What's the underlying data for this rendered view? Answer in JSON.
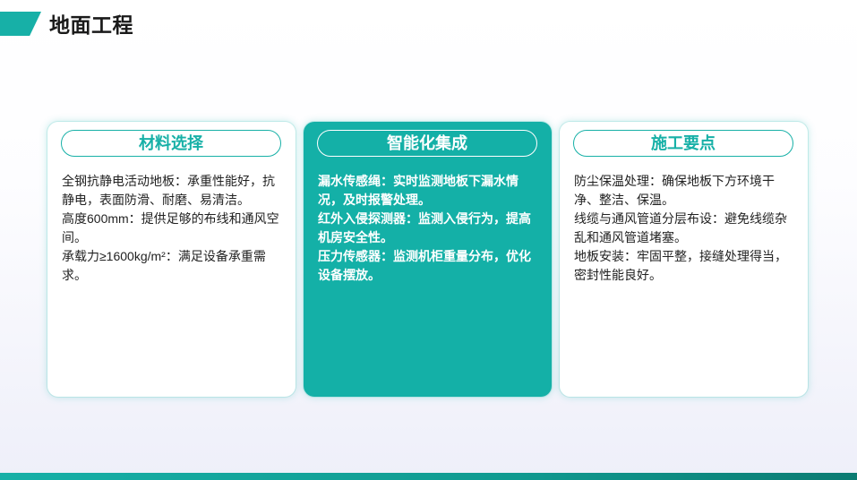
{
  "page": {
    "title": "地面工程"
  },
  "colors": {
    "accent": "#17b0a7",
    "accent_dark": "#0b7b72",
    "highlight_card_bg": "#14b0a7",
    "highlight_text": "#ffffff",
    "body_text": "#222222",
    "title_text": "#1a1a1a"
  },
  "cards": [
    {
      "title": "材料选择",
      "items": [
        "全钢抗静电活动地板：承重性能好，抗静电，表面防滑、耐磨、易清洁。",
        "高度600mm：提供足够的布线和通风空间。",
        "承载力≥1600kg/m²：满足设备承重需求。"
      ]
    },
    {
      "title": "智能化集成",
      "items": [
        "漏水传感绳：实时监测地板下漏水情况，及时报警处理。",
        "红外入侵探测器：监测入侵行为，提高机房安全性。",
        "压力传感器：监测机柜重量分布，优化设备摆放。"
      ]
    },
    {
      "title": "施工要点",
      "items": [
        "防尘保温处理：确保地板下方环境干净、整洁、保温。",
        "线缆与通风管道分层布设：避免线缆杂乱和通风管道堵塞。",
        "地板安装：牢固平整，接缝处理得当，密封性能良好。"
      ]
    }
  ]
}
